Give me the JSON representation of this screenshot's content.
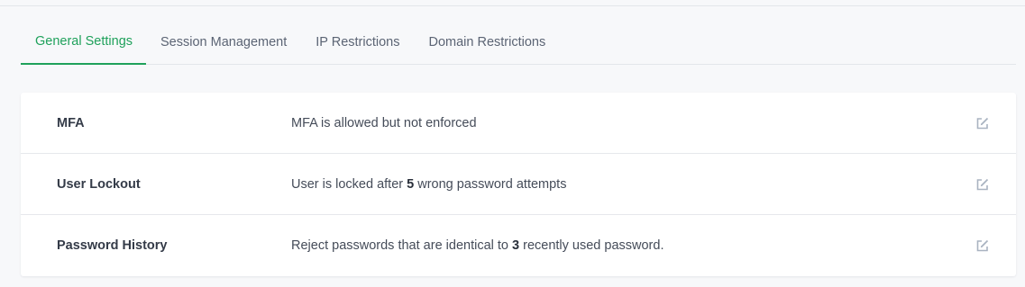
{
  "tabs": [
    {
      "label": "General Settings",
      "active": true
    },
    {
      "label": "Session Management",
      "active": false
    },
    {
      "label": "IP Restrictions",
      "active": false
    },
    {
      "label": "Domain Restrictions",
      "active": false
    }
  ],
  "settings": [
    {
      "label": "MFA",
      "desc_before": "MFA is allowed but not enforced",
      "desc_value": "",
      "desc_after": "",
      "action_icon": "edit-icon"
    },
    {
      "label": "User Lockout",
      "desc_before": "User is locked after ",
      "desc_value": "5",
      "desc_after": " wrong password attempts",
      "action_icon": "edit-icon"
    },
    {
      "label": "Password History",
      "desc_before": "Reject passwords that are identical to ",
      "desc_value": "3",
      "desc_after": " recently used password.",
      "action_icon": "edit-icon"
    }
  ],
  "colors": {
    "accent": "#1fa15b",
    "icon": "#a9b3c1"
  }
}
